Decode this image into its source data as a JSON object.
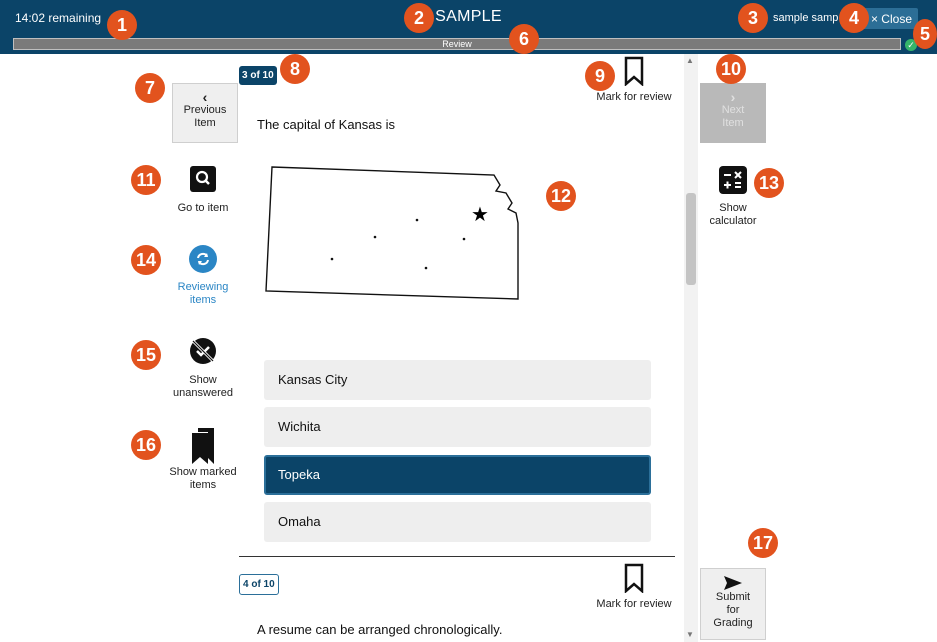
{
  "header": {
    "time_remaining": "14:02 remaining",
    "title": "SAMPLE",
    "user_name": "sample samp",
    "close_label": "× Close",
    "progress_label": "Review"
  },
  "callouts": [
    "1",
    "2",
    "3",
    "4",
    "5",
    "6",
    "7",
    "8",
    "9",
    "10",
    "11",
    "12",
    "13",
    "14",
    "15",
    "16",
    "17"
  ],
  "left_tools": {
    "previous_label_1": "Previous",
    "previous_label_2": "Item",
    "go_to_item": "Go to item",
    "reviewing_1": "Reviewing",
    "reviewing_2": "items",
    "unanswered_1": "Show",
    "unanswered_2": "unanswered",
    "marked_1": "Show marked",
    "marked_2": "items"
  },
  "right_tools": {
    "next_label_1": "Next",
    "next_label_2": "Item",
    "calc_1": "Show",
    "calc_2": "calculator",
    "submit_1": "Submit",
    "submit_2": "for",
    "submit_3": "Grading"
  },
  "question1": {
    "counter": "3 of 10",
    "mark_label": "Mark for review",
    "stem": "The capital of Kansas is",
    "options": [
      "Kansas City",
      "Wichita",
      "Topeka",
      "Omaha"
    ],
    "selected": "Topeka"
  },
  "question2": {
    "counter": "4 of 10",
    "mark_label": "Mark for review",
    "stem": "A resume can be arranged chronologically."
  },
  "colors": {
    "header_bg": "#0b4468",
    "callout": "#e2531e",
    "reviewing_blue": "#2b86c5",
    "selected_bg": "#0b4468"
  },
  "icons": [
    "search-icon",
    "refresh-icon",
    "no-answer-icon",
    "bookmarks-icon",
    "bookmark-icon",
    "calculator-icon",
    "send-icon",
    "chevron-left-icon",
    "chevron-right-icon",
    "star-icon",
    "check-icon",
    "close-icon"
  ]
}
